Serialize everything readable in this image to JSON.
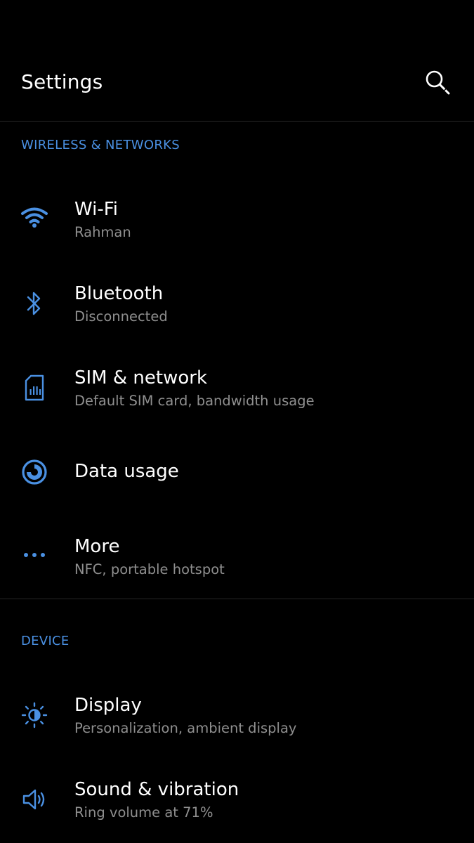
{
  "header": {
    "title": "Settings",
    "search_icon": "search-icon"
  },
  "colors": {
    "accent": "#4a90e2",
    "background": "#000000",
    "primary_text": "#ffffff",
    "secondary_text": "#8f8f8f",
    "divider": "#262626"
  },
  "sections": [
    {
      "header": "WIRELESS & NETWORKS",
      "items": [
        {
          "title": "Wi-Fi",
          "subtitle": "Rahman",
          "icon": "wifi-icon"
        },
        {
          "title": "Bluetooth",
          "subtitle": "Disconnected",
          "icon": "bluetooth-icon"
        },
        {
          "title": "SIM & network",
          "subtitle": "Default SIM card, bandwidth usage",
          "icon": "sim-card-icon"
        },
        {
          "title": "Data usage",
          "subtitle": "",
          "icon": "data-usage-icon"
        },
        {
          "title": "More",
          "subtitle": "NFC, portable hotspot",
          "icon": "more-dots-icon"
        }
      ]
    },
    {
      "header": "DEVICE",
      "items": [
        {
          "title": "Display",
          "subtitle": "Personalization, ambient display",
          "icon": "brightness-icon"
        },
        {
          "title": "Sound & vibration",
          "subtitle": "Ring volume at 71%",
          "icon": "volume-icon"
        }
      ]
    }
  ]
}
